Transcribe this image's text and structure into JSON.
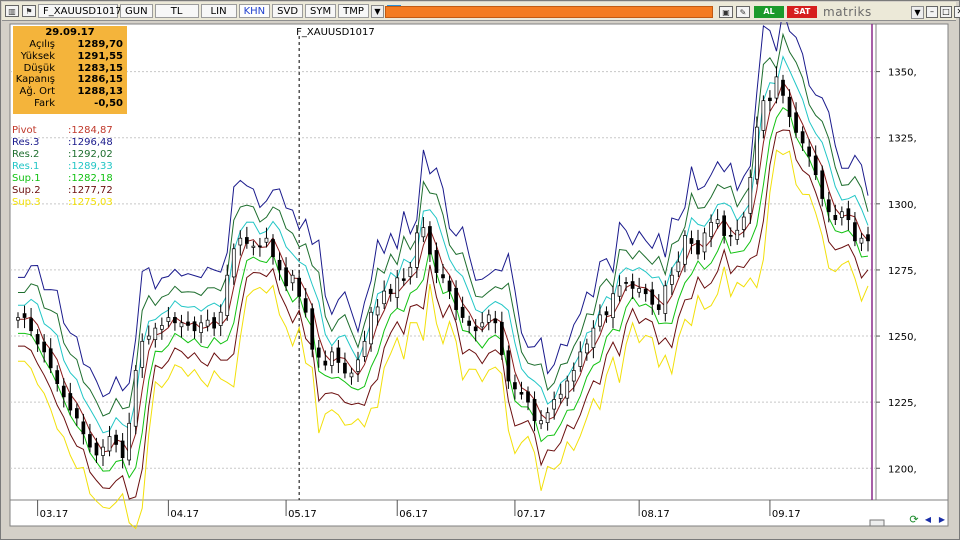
{
  "toolbar": {
    "symbol": "F_XAUUSD1017",
    "buttons": [
      "GUN",
      "TL",
      "LIN",
      "KHN",
      "SVD",
      "SYM",
      "TMP"
    ],
    "active_button": "KHN",
    "al_label": "AL",
    "sat_label": "SAT",
    "brand": "matriks"
  },
  "info_box": {
    "date": "29.09.17",
    "rows": [
      {
        "label": "Açılış",
        "value": "1289,70"
      },
      {
        "label": "Yüksek",
        "value": "1291,55"
      },
      {
        "label": "Düşük",
        "value": "1283,15"
      },
      {
        "label": "Kapanış",
        "value": "1286,15"
      },
      {
        "label": "Ağ. Ort",
        "value": "1288,13"
      },
      {
        "label": "Fark",
        "value": "-0,50"
      }
    ]
  },
  "pivot_levels": [
    {
      "label": "Pivot",
      "value": ":1284,87",
      "color": "#c0392b"
    },
    {
      "label": "Res.3",
      "value": ":1296,48",
      "color": "#1a1a8c"
    },
    {
      "label": "Res.2",
      "value": ":1292,02",
      "color": "#1e6e2e"
    },
    {
      "label": "Res.1",
      "value": ":1289,33",
      "color": "#22c6c6"
    },
    {
      "label": "Sup.1",
      "value": ":1282,18",
      "color": "#12c212"
    },
    {
      "label": "Sup.2",
      "value": ":1277,72",
      "color": "#6b0f0f"
    },
    {
      "label": "Sup.3",
      "value": ":1275,03",
      "color": "#f2e00a"
    }
  ],
  "chart_data": {
    "type": "candlestick",
    "title": "F_XAUUSD1017",
    "y_ticks": [
      1200,
      1225,
      1250,
      1275,
      1300,
      1325,
      1350
    ],
    "y_tick_labels": [
      "1200,",
      "1225,",
      "1250,",
      "1275,",
      "1300,",
      "1325,",
      "1350,"
    ],
    "ylim": [
      1188,
      1368
    ],
    "x_tick_labels": [
      "03.17",
      "04.17",
      "05.17",
      "06.17",
      "07.17",
      "08.17",
      "09.17"
    ],
    "x_tick_index": [
      3,
      23,
      41,
      58,
      76,
      95,
      115
    ],
    "vertical_marker_index": 43,
    "grid": true,
    "series": [
      {
        "name": "Pivot",
        "color": "#8b1a1a"
      },
      {
        "name": "Res.3",
        "color": "#1a1a8c"
      },
      {
        "name": "Res.2",
        "color": "#1e6e2e"
      },
      {
        "name": "Res.1",
        "color": "#22c6c6"
      },
      {
        "name": "Sup.1",
        "color": "#12c212"
      },
      {
        "name": "Sup.2",
        "color": "#6b0f0f"
      },
      {
        "name": "Sup.3",
        "color": "#f2e00a"
      }
    ],
    "close": [
      1257,
      1257,
      1252,
      1247,
      1244,
      1238,
      1232,
      1227,
      1222,
      1219,
      1213,
      1208,
      1205,
      1208,
      1212,
      1209,
      1204,
      1217,
      1237,
      1248,
      1250,
      1253,
      1254,
      1257,
      1255,
      1255,
      1254,
      1252,
      1255,
      1256,
      1253,
      1259,
      1273,
      1283,
      1287,
      1285,
      1284,
      1284,
      1287,
      1280,
      1275,
      1269,
      1273,
      1265,
      1259,
      1245,
      1242,
      1239,
      1244,
      1240,
      1236,
      1236,
      1241,
      1248,
      1259,
      1261,
      1267,
      1266,
      1272,
      1271,
      1276,
      1289,
      1291,
      1281,
      1274,
      1272,
      1267,
      1260,
      1257,
      1254,
      1252,
      1255,
      1258,
      1255,
      1243,
      1233,
      1230,
      1228,
      1225,
      1218,
      1218,
      1221,
      1226,
      1228,
      1233,
      1237,
      1244,
      1247,
      1253,
      1258,
      1258,
      1266,
      1269,
      1270,
      1268,
      1268,
      1266,
      1262,
      1260,
      1269,
      1273,
      1278,
      1288,
      1285,
      1281,
      1289,
      1293,
      1294,
      1288,
      1288,
      1290,
      1295,
      1310,
      1329,
      1339,
      1339,
      1348,
      1341,
      1333,
      1327,
      1323,
      1318,
      1311,
      1302,
      1297,
      1294,
      1297,
      1294,
      1286,
      1287,
      1286
    ]
  }
}
